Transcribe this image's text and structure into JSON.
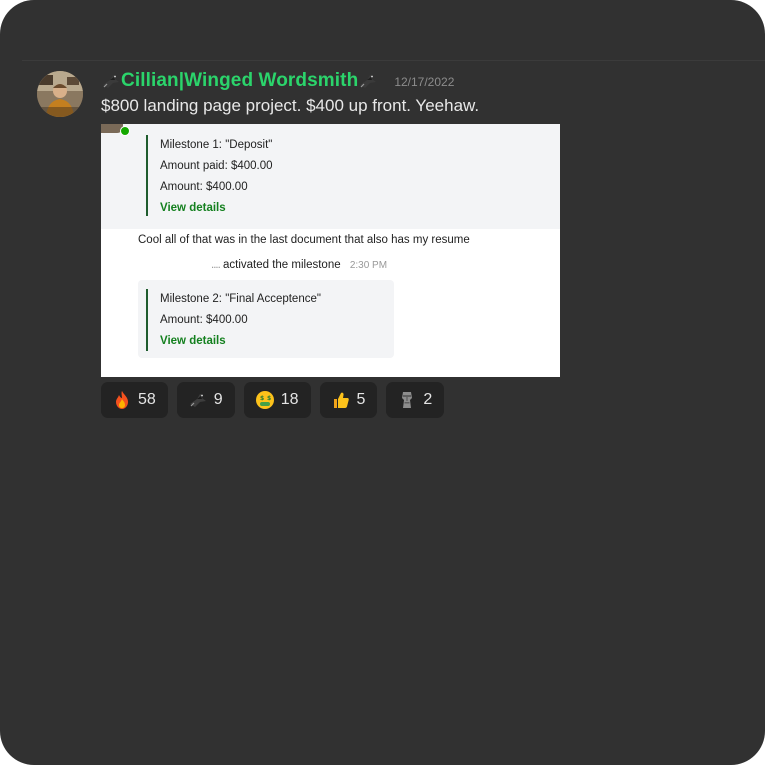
{
  "message": {
    "author": "Cillian|Winged Wordsmith",
    "timestamp": "12/17/2022",
    "text": "$800 landing page project. $400 up front. Yeehaw."
  },
  "attachment": {
    "milestone1": {
      "title": "Milestone 1: \"Deposit\"",
      "paid": "Amount paid: $400.00",
      "amount": "Amount: $400.00",
      "link": "View details"
    },
    "chat_line": "Cool all of that was in the last document that also has my resume",
    "activity": {
      "user": "....",
      "text": "activated the milestone",
      "time": "2:30 PM"
    },
    "milestone2": {
      "title": "Milestone 2: \"Final Acceptence\"",
      "amount": "Amount: $400.00",
      "link": "View details"
    }
  },
  "reactions": [
    {
      "icon": "fire-icon",
      "count": "58"
    },
    {
      "icon": "crow-icon",
      "count": "9"
    },
    {
      "icon": "money-mouth-face-icon",
      "count": "18"
    },
    {
      "icon": "thumbs-up-icon",
      "count": "5"
    },
    {
      "icon": "moai-icon",
      "count": "2"
    }
  ],
  "colors": {
    "author": "#2bd46b",
    "background": "#313131",
    "reaction_bg": "#232323",
    "link_green": "#14801f"
  }
}
